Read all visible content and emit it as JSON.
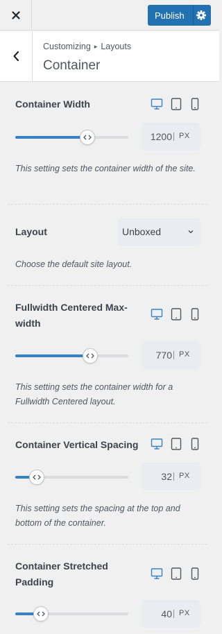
{
  "topbar": {
    "publish_label": "Publish"
  },
  "header": {
    "breadcrumb_root": "Customizing",
    "breadcrumb_sep": "▸",
    "breadcrumb_parent": "Layouts",
    "title": "Container"
  },
  "colors": {
    "accent": "#2271b1",
    "slider_fill": "#3582c4",
    "active_device": "#3582c4",
    "inactive_device": "#50575e"
  },
  "controls": [
    {
      "label": "Container Width",
      "device_active": "desktop",
      "slider_percent": 64,
      "value": "1200",
      "unit": "PX",
      "description": "This setting sets the container width of the site."
    },
    {
      "label": "Layout",
      "select_value": "Unboxed",
      "description": "Choose the default site layout."
    },
    {
      "label": "Fullwidth Centered Max-width",
      "device_active": "desktop",
      "slider_percent": 66,
      "value": "770",
      "unit": "PX",
      "description": "This setting sets the container width for a Fullwidth Centered layout."
    },
    {
      "label": "Container Vertical Spacing",
      "device_active": "desktop",
      "slider_percent": 19,
      "value": "32",
      "unit": "PX",
      "description": "This setting sets the spacing at the top and bottom of the container."
    },
    {
      "label": "Container Stretched Padding",
      "device_active": "desktop",
      "slider_percent": 23,
      "value": "40",
      "unit": "PX"
    }
  ]
}
